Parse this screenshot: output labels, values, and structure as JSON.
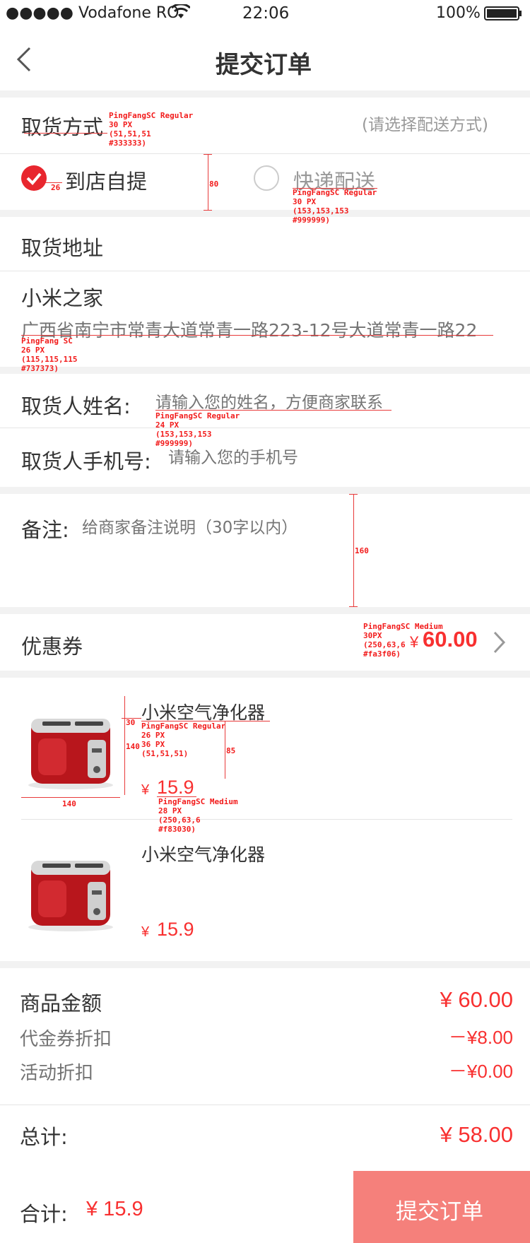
{
  "status_bar": {
    "carrier": "●●●●● Vodafone RO",
    "time": "22:06",
    "battery": "100%"
  },
  "nav": {
    "title": "提交订单",
    "back_icon": "chevron-left-icon"
  },
  "pickup": {
    "label": "取货方式",
    "hint": "(请选择配送方式)",
    "options": [
      {
        "label": "到店自提",
        "checked": true
      },
      {
        "label": "快递配送",
        "checked": false
      }
    ]
  },
  "address": {
    "section_label": "取货地址",
    "store_name": "小米之家",
    "store_address": "广西省南宁市常青大道常青一路223-12号大道常青一路22"
  },
  "contact": {
    "name_label": "取货人姓名:",
    "name_placeholder": "请输入您的姓名，方便商家联系",
    "phone_label": "取货人手机号:",
    "phone_placeholder": "请输入您的手机号"
  },
  "remark": {
    "label": "备注:",
    "placeholder": "给商家备注说明（30字以内）"
  },
  "coupon": {
    "label": "优惠券",
    "currency": "¥",
    "amount": "60.00"
  },
  "products": [
    {
      "name": "小米空气净化器",
      "currency": "¥",
      "price": "15.9"
    },
    {
      "name": "小米空气净化器",
      "currency": "¥",
      "price": "15.9"
    }
  ],
  "summary": {
    "goods_label": "商品金额",
    "goods_value": "¥ 60.00",
    "coupon_label": "代金券折扣",
    "coupon_value": "－¥8.00",
    "activity_label": "活动折扣",
    "activity_value": "－¥0.00",
    "total_label": "总计:",
    "total_value": "¥ 58.00"
  },
  "footer": {
    "sum_label": "合计:",
    "sum_value": "¥ 15.9",
    "submit_label": "提交订单"
  },
  "annotations": {
    "a1": "PingFangSC Regular\n30 PX\n(51,51,51\n#333333)",
    "a2": "26",
    "a3": "80",
    "a4": "PingFangSC Regular\n30 PX\n(153,153,153\n#999999)",
    "a5": "PingFang SC\n26 PX\n(115,115,115\n#737373)",
    "a6": "PingFangSC Regular\n24 PX\n(153,153,153\n#999999)",
    "a7": "160",
    "a8": "PingFangSC Medium\n30PX\n(250,63,6\n#fa3f06)",
    "a9": "30",
    "a10": "PingFangSC Regular\n26 PX\n36 PX\n(51,51,51)",
    "a11": "140",
    "a12": "85",
    "a13": "140",
    "a14": "PingFangSC Medium\n28 PX\n(250,63,6\n#f83030)"
  },
  "colors": {
    "accent": "#f83030",
    "submit_bg": "#f5807b",
    "check": "#e8262e"
  }
}
